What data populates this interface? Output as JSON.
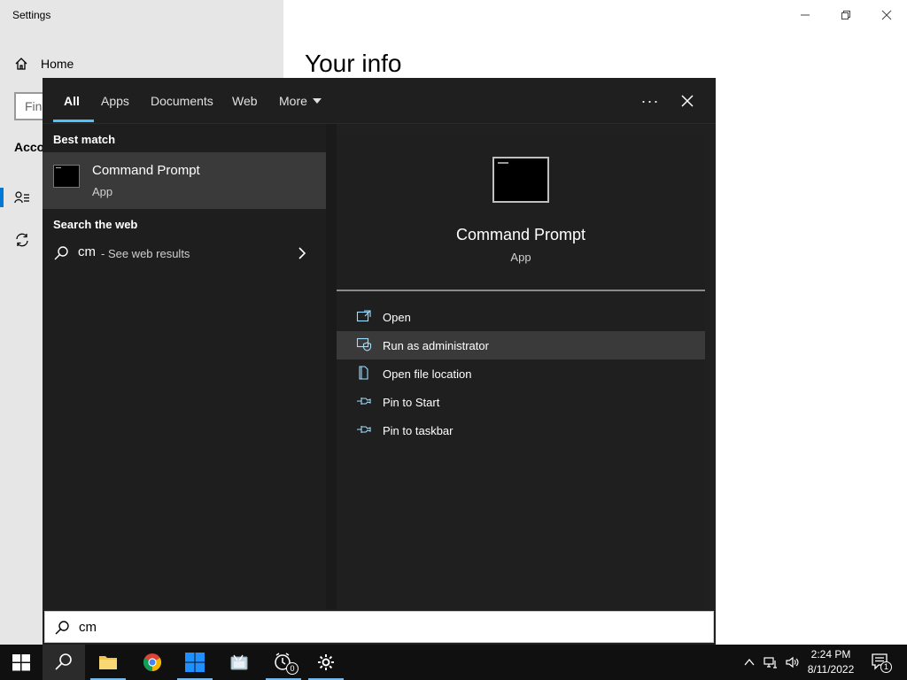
{
  "settings": {
    "window_title": "Settings",
    "nav_home_label": "Home",
    "find_placeholder": "Fin",
    "section_label": "Acco",
    "page_title": "Your info"
  },
  "search": {
    "tabs": [
      {
        "label": "All",
        "active": true
      },
      {
        "label": "Apps"
      },
      {
        "label": "Documents"
      },
      {
        "label": "Web"
      },
      {
        "label": "More"
      }
    ],
    "ellipsis_label": "···",
    "best_match_heading": "Best match",
    "best_match": {
      "name": "Command Prompt",
      "type": "App"
    },
    "web_heading": "Search the web",
    "web_result": {
      "query": "cm",
      "suffix": " - See web results"
    },
    "preview": {
      "name": "Command Prompt",
      "type": "App"
    },
    "actions": [
      {
        "label": "Open",
        "icon": "open-icon"
      },
      {
        "label": "Run as administrator",
        "icon": "shield-icon"
      },
      {
        "label": "Open file location",
        "icon": "file-location-icon"
      },
      {
        "label": "Pin to Start",
        "icon": "pin-icon"
      },
      {
        "label": "Pin to taskbar",
        "icon": "pin-icon"
      }
    ],
    "query_value": "cm"
  },
  "taskbar": {
    "time": "2:24 PM",
    "date": "8/11/2022",
    "notification_count": "1",
    "alarm_badge": "0"
  },
  "colors": {
    "accent": "#0078d7",
    "tab_underline": "#4cc2ff",
    "flyout_bg": "#202020",
    "taskbar_bg": "#101010"
  }
}
